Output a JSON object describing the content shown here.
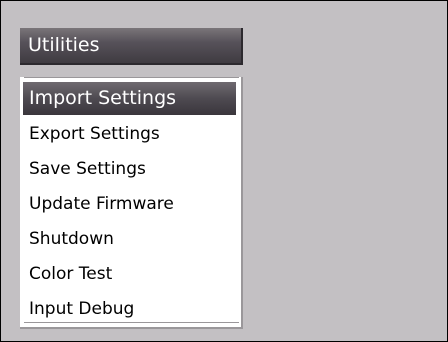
{
  "menu": {
    "title": "Utilities",
    "items": [
      {
        "label": "Import Settings",
        "selected": true
      },
      {
        "label": "Export Settings",
        "selected": false
      },
      {
        "label": "Save Settings",
        "selected": false
      },
      {
        "label": "Update Firmware",
        "selected": false
      },
      {
        "label": "Shutdown",
        "selected": false
      },
      {
        "label": "Color Test",
        "selected": false
      },
      {
        "label": "Input Debug",
        "selected": false
      }
    ]
  },
  "colors": {
    "background": "#c3c0c3",
    "header": "#4e4a51",
    "selection": "#4e4a51",
    "list_background": "#ffffff"
  }
}
